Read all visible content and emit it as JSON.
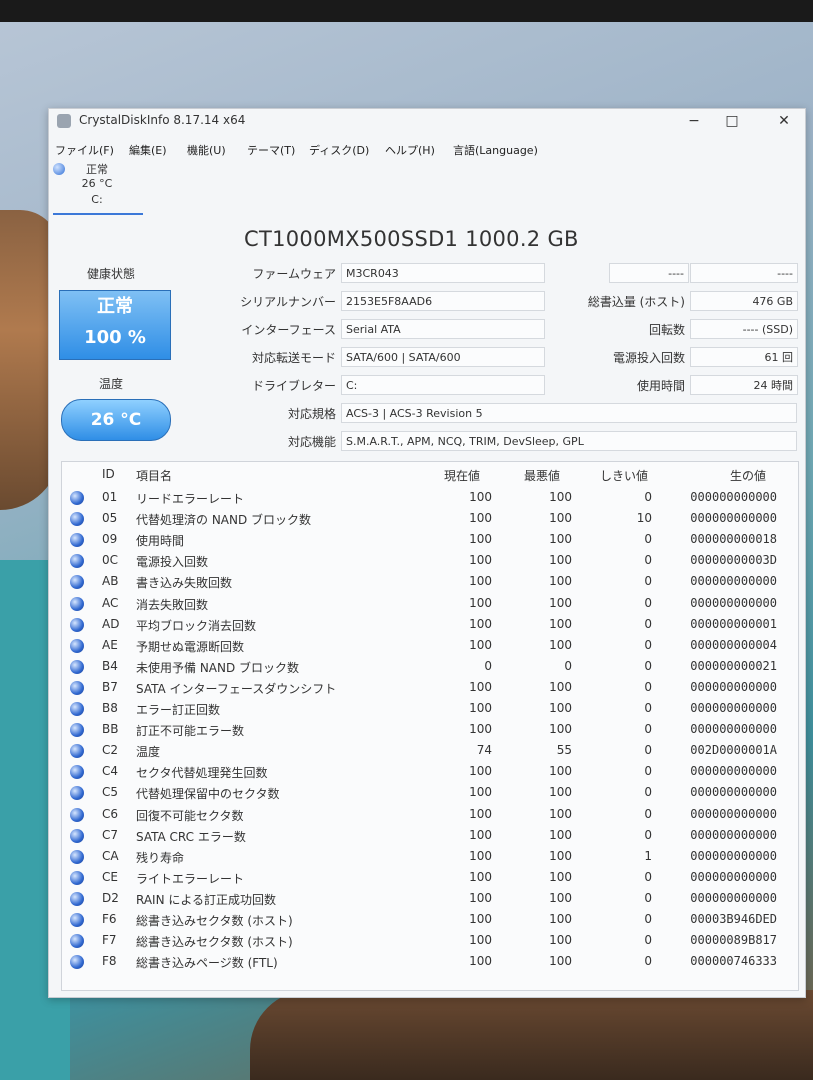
{
  "window": {
    "title": "CrystalDiskInfo 8.17.14 x64",
    "minimize": "−",
    "maximize": "□",
    "close": "✕"
  },
  "menu": [
    "ファイル(F)",
    "編集(E)",
    "機能(U)",
    "テーマ(T)",
    "ディスク(D)",
    "ヘルプ(H)",
    "言語(Language)"
  ],
  "disk_tab": {
    "status": "正常",
    "temp": "26 °C",
    "drive": "C:"
  },
  "model": "CT1000MX500SSD1 1000.2 GB",
  "health": {
    "label": "健康状態",
    "status": "正常",
    "percent": "100 %"
  },
  "temperature": {
    "label": "温度",
    "value": "26 °C"
  },
  "info": {
    "firmware": {
      "label": "ファームウェア",
      "value": "M3CR043"
    },
    "serial": {
      "label": "シリアルナンバー",
      "value": "2153E5F8AAD6"
    },
    "interface": {
      "label": "インターフェース",
      "value": "Serial ATA"
    },
    "transfer": {
      "label": "対応転送モード",
      "value": "SATA/600 | SATA/600"
    },
    "drive_letter": {
      "label": "ドライブレター",
      "value": "C:"
    },
    "standard": {
      "label": "対応規格",
      "value": "ACS-3 | ACS-3 Revision 5"
    },
    "features": {
      "label": "対応機能",
      "value": "S.M.A.R.T., APM, NCQ, TRIM, DevSleep, GPL"
    }
  },
  "right_info": {
    "blank1": "----",
    "blank2": "----",
    "host_writes": {
      "label": "総書込量 (ホスト)",
      "value": "476 GB"
    },
    "rotation": {
      "label": "回転数",
      "value": "---- (SSD)"
    },
    "power_count": {
      "label": "電源投入回数",
      "value": "61 回"
    },
    "power_hours": {
      "label": "使用時間",
      "value": "24 時間"
    }
  },
  "smart_headers": {
    "id": "ID",
    "name": "項目名",
    "current": "現在値",
    "worst": "最悪値",
    "threshold": "しきい値",
    "raw": "生の値"
  },
  "smart_rows": [
    {
      "id": "01",
      "name": "リードエラーレート",
      "cur": "100",
      "worst": "100",
      "thr": "0",
      "raw": "000000000000"
    },
    {
      "id": "05",
      "name": "代替処理済の NAND ブロック数",
      "cur": "100",
      "worst": "100",
      "thr": "10",
      "raw": "000000000000"
    },
    {
      "id": "09",
      "name": "使用時間",
      "cur": "100",
      "worst": "100",
      "thr": "0",
      "raw": "000000000018"
    },
    {
      "id": "0C",
      "name": "電源投入回数",
      "cur": "100",
      "worst": "100",
      "thr": "0",
      "raw": "00000000003D"
    },
    {
      "id": "AB",
      "name": "書き込み失敗回数",
      "cur": "100",
      "worst": "100",
      "thr": "0",
      "raw": "000000000000"
    },
    {
      "id": "AC",
      "name": "消去失敗回数",
      "cur": "100",
      "worst": "100",
      "thr": "0",
      "raw": "000000000000"
    },
    {
      "id": "AD",
      "name": "平均ブロック消去回数",
      "cur": "100",
      "worst": "100",
      "thr": "0",
      "raw": "000000000001"
    },
    {
      "id": "AE",
      "name": "予期せぬ電源断回数",
      "cur": "100",
      "worst": "100",
      "thr": "0",
      "raw": "000000000004"
    },
    {
      "id": "B4",
      "name": "未使用予備 NAND ブロック数",
      "cur": "0",
      "worst": "0",
      "thr": "0",
      "raw": "000000000021"
    },
    {
      "id": "B7",
      "name": "SATA インターフェースダウンシフト",
      "cur": "100",
      "worst": "100",
      "thr": "0",
      "raw": "000000000000"
    },
    {
      "id": "B8",
      "name": "エラー訂正回数",
      "cur": "100",
      "worst": "100",
      "thr": "0",
      "raw": "000000000000"
    },
    {
      "id": "BB",
      "name": "訂正不可能エラー数",
      "cur": "100",
      "worst": "100",
      "thr": "0",
      "raw": "000000000000"
    },
    {
      "id": "C2",
      "name": "温度",
      "cur": "74",
      "worst": "55",
      "thr": "0",
      "raw": "002D0000001A"
    },
    {
      "id": "C4",
      "name": "セクタ代替処理発生回数",
      "cur": "100",
      "worst": "100",
      "thr": "0",
      "raw": "000000000000"
    },
    {
      "id": "C5",
      "name": "代替処理保留中のセクタ数",
      "cur": "100",
      "worst": "100",
      "thr": "0",
      "raw": "000000000000"
    },
    {
      "id": "C6",
      "name": "回復不可能セクタ数",
      "cur": "100",
      "worst": "100",
      "thr": "0",
      "raw": "000000000000"
    },
    {
      "id": "C7",
      "name": "SATA CRC エラー数",
      "cur": "100",
      "worst": "100",
      "thr": "0",
      "raw": "000000000000"
    },
    {
      "id": "CA",
      "name": "残り寿命",
      "cur": "100",
      "worst": "100",
      "thr": "1",
      "raw": "000000000000"
    },
    {
      "id": "CE",
      "name": "ライトエラーレート",
      "cur": "100",
      "worst": "100",
      "thr": "0",
      "raw": "000000000000"
    },
    {
      "id": "D2",
      "name": "RAIN による訂正成功回数",
      "cur": "100",
      "worst": "100",
      "thr": "0",
      "raw": "000000000000"
    },
    {
      "id": "F6",
      "name": "総書き込みセクタ数 (ホスト)",
      "cur": "100",
      "worst": "100",
      "thr": "0",
      "raw": "00003B946DED"
    },
    {
      "id": "F7",
      "name": "総書き込みセクタ数 (ホスト)",
      "cur": "100",
      "worst": "100",
      "thr": "0",
      "raw": "00000089B817"
    },
    {
      "id": "F8",
      "name": "総書き込みページ数 (FTL)",
      "cur": "100",
      "worst": "100",
      "thr": "0",
      "raw": "000000746333"
    }
  ]
}
